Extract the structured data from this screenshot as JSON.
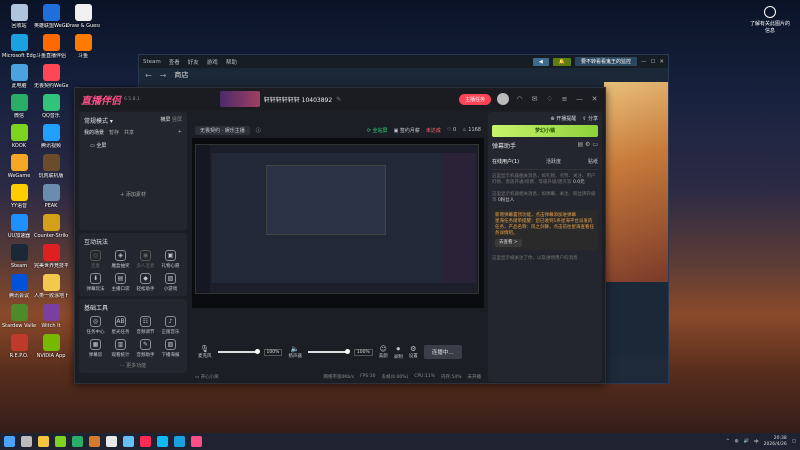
{
  "desktop": {
    "icons": [
      {
        "label": "回收站",
        "color": "#b0c4de"
      },
      {
        "label": "英雄联盟WeGame版",
        "color": "#1e6fd9"
      },
      {
        "label": "Draw & Guess - 你...",
        "color": "#f0f0f0"
      },
      {
        "label": "Microsoft Edge",
        "color": "#1ba1e2"
      },
      {
        "label": "斗鱼直播伴侣",
        "color": "#ff6a00"
      },
      {
        "label": "斗鱼",
        "color": "#ff7a00"
      },
      {
        "label": "此电脑",
        "color": "#4aa3df"
      },
      {
        "label": "无畏契约WeGame版",
        "color": "#ff4655"
      },
      {
        "label": "微信",
        "color": "#2aae67"
      },
      {
        "label": "QQ音乐",
        "color": "#31c27c"
      },
      {
        "label": "KOOK",
        "color": "#7ed321"
      },
      {
        "label": "腾讯视频",
        "color": "#20a0ff"
      },
      {
        "label": "WeGame",
        "color": "#f5a623"
      },
      {
        "label": "饥荒联机版",
        "color": "#6b4c2a"
      },
      {
        "label": "YY语音",
        "color": "#ffcc00"
      },
      {
        "label": "PEAK",
        "color": "#6a8caf"
      },
      {
        "label": "UU加速器",
        "color": "#1e90ff"
      },
      {
        "label": "Counter-Strike 2",
        "color": "#d4a017"
      },
      {
        "label": "Steam",
        "color": "#1b2838"
      },
      {
        "label": "完美世界竞技平台",
        "color": "#e02020"
      },
      {
        "label": "腾讯会议",
        "color": "#0052d9"
      },
      {
        "label": "人类一败涂地 Human Fa...",
        "color": "#f2c94c"
      },
      {
        "label": "Stardew Valley",
        "color": "#4c8a2a"
      },
      {
        "label": "Witch It",
        "color": "#7a3fa0"
      },
      {
        "label": "R.E.P.O.",
        "color": "#c0392b"
      },
      {
        "label": "NVIDIA App",
        "color": "#76b900"
      }
    ],
    "widget_label": "了解有关此图片的信息"
  },
  "steam": {
    "menu": [
      "Steam",
      "查看",
      "好友",
      "游戏",
      "帮助"
    ],
    "btn_notify": "通知",
    "btn_green": "",
    "account": "要不转看看鬼王的监控",
    "nav_title": "商店",
    "nav_sub": "库",
    "bg_text": "新开注册新品发布"
  },
  "zhibo": {
    "logo": "直播伴侣",
    "version": "6.5.8.1",
    "streamer_name": "轩轩轩轩轩轩 10403892",
    "thumb_caption": "已开启直播画面",
    "account_tag": "无畏契约 · 娱乐主播",
    "btn_red": "主播任务",
    "badge_new": "New",
    "center_header": {
      "fullscreen": "全屏",
      "status_green": "全站屏",
      "status_record": "签约月薪",
      "status_red": "未达成",
      "like": "0",
      "heat": "1168",
      "open_live": "开播提醒",
      "share": "分享"
    },
    "left": {
      "mode": "常规模式",
      "mode_links": [
        "横屏",
        "竖屏"
      ],
      "my_scene": "我的场景",
      "scene_links": [
        "暂存",
        "共享"
      ],
      "scene_item": "全屏",
      "add_source": "添加素材",
      "interactive_title": "互动玩法",
      "interactive": [
        {
          "label": "连麦",
          "icon": "◎",
          "dim": true
        },
        {
          "label": "魔盒抽奖",
          "icon": "◈",
          "dim": false
        },
        {
          "label": "多人连麦",
          "icon": "◉",
          "dim": true
        },
        {
          "label": "礼物心愿",
          "icon": "▣",
          "dim": false
        },
        {
          "label": "弹幕玩法",
          "icon": "⬇",
          "dim": false
        },
        {
          "label": "主播口袋",
          "icon": "▤",
          "dim": false
        },
        {
          "label": "轻松助手",
          "icon": "◆",
          "dim": false
        },
        {
          "label": "小游戏",
          "icon": "▧",
          "dim": false
        }
      ],
      "basic_title": "基础工具",
      "basic": [
        {
          "label": "任务中心",
          "icon": "◎"
        },
        {
          "label": "星光任务",
          "icon": "AB"
        },
        {
          "label": "音频调节",
          "icon": "☷"
        },
        {
          "label": "正版音乐",
          "icon": "♪"
        },
        {
          "label": "弹幕房",
          "icon": "▦"
        },
        {
          "label": "观看统计",
          "icon": "▥"
        },
        {
          "label": "音频助手",
          "icon": "✎"
        },
        {
          "label": "下播海报",
          "icon": "▨"
        }
      ],
      "more": "更多功能"
    },
    "controls": {
      "mic": "麦克风",
      "mic_pct": "100%",
      "speaker": "扬声器",
      "speaker_pct": "100%",
      "beauty": "美颜",
      "record": "录制",
      "settings": "设置",
      "live_btn": "连播中...",
      "mini": "开心小窝"
    },
    "status": {
      "bitrate": "网络带宽0Kb/s",
      "fps": "FPS:30",
      "loss": "丢帧(0.00%)",
      "cpu": "CPU:11%",
      "mem": "内存:54%",
      "stable": "未开播"
    },
    "right": {
      "title": "弹幕助手",
      "banner": "梦幻小镇",
      "tabs": [
        "在线用户(1)",
        "活跃度",
        "贴纸"
      ],
      "msg1": "这里显示机器相关消息，如礼物、点赞、关注、用户打榜、贵族开通/续费、等级升级/熄灭等",
      "counter": "0.0",
      "counter_unit": "元",
      "msg2": "这里显示机器相关消息，如弹幕、关注、粉丝牌升级等",
      "fans": "0粉丝人",
      "notice_title": "新增弹幕置顶功能，点击弹幕添加进弹幕",
      "notice_body": "星海任务储单提醒：您已收到1条星海平台派发的任务，产品名称：风之剑舞，点击前往星海查看任务详情吧。",
      "notice_link": "去查看",
      "msg3": "这里显示被关注了你，以及进场用户的消息"
    }
  },
  "taskbar": {
    "icons": [
      {
        "name": "windows-icon",
        "color": "#4aa3ff"
      },
      {
        "name": "search-icon",
        "color": "#bbbbbb"
      },
      {
        "name": "file-explorer-icon",
        "color": "#f5c542"
      },
      {
        "name": "kook-icon",
        "color": "#7ed321"
      },
      {
        "name": "wechat-icon",
        "color": "#2aae67"
      },
      {
        "name": "game-icon",
        "color": "#d47a2a"
      },
      {
        "name": "chrome-icon",
        "color": "#e8e8e8"
      },
      {
        "name": "steam-icon",
        "color": "#66c0f4"
      },
      {
        "name": "douyin-icon",
        "color": "#ff2a55"
      },
      {
        "name": "qq-icon",
        "color": "#12b7f5"
      },
      {
        "name": "edge-icon",
        "color": "#1ba1e2"
      },
      {
        "name": "live-icon",
        "color": "#ff4f86"
      }
    ],
    "time": "20:38",
    "date": "2026/4/26",
    "lang": "中"
  }
}
